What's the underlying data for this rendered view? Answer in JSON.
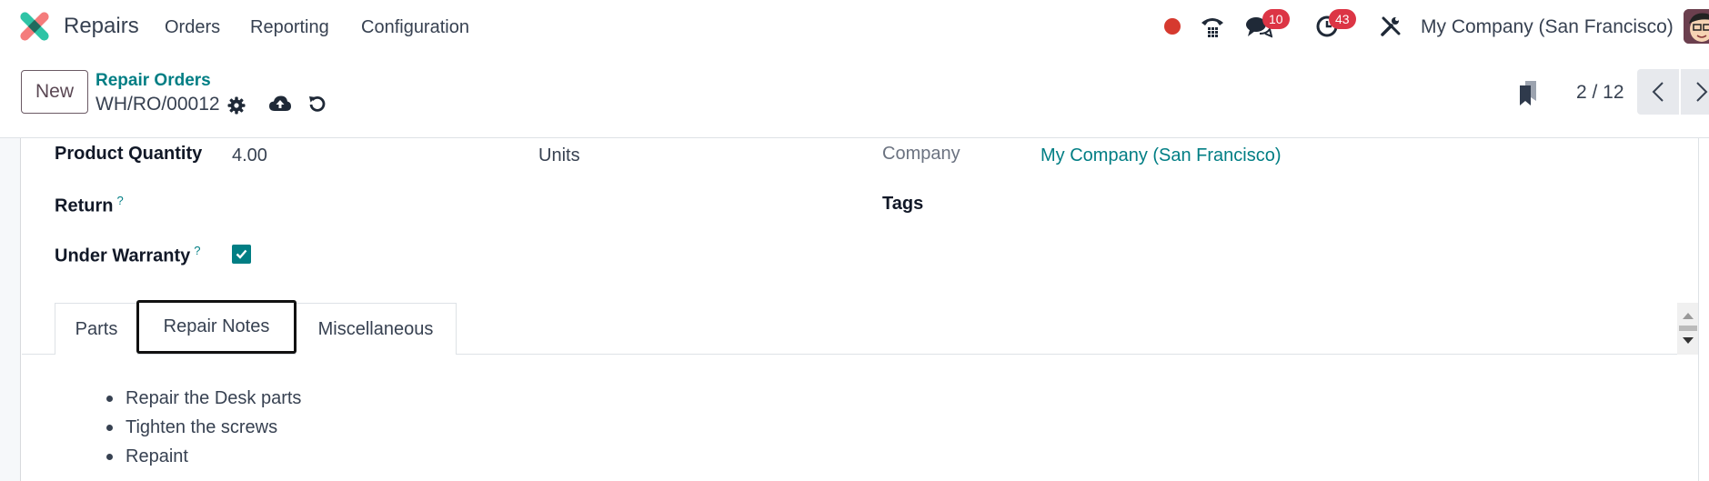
{
  "navbar": {
    "app_name": "Repairs",
    "menu": [
      "Orders",
      "Reporting",
      "Configuration"
    ],
    "status_dot_color": "#d63a2f",
    "messages_count": "10",
    "activities_count": "43",
    "company": "My Company (San Francisco)"
  },
  "control_panel": {
    "new_label": "New",
    "breadcrumb_parent": "Repair Orders",
    "breadcrumb_current": "WH/RO/00012",
    "pager_value": "2 / 12"
  },
  "form": {
    "product_quantity_label": "Product Quantity",
    "product_quantity_value": "4.00",
    "uom_value": "Units",
    "return_label": "Return",
    "help_mark": "?",
    "under_warranty_label": "Under Warranty",
    "under_warranty_checked": true,
    "company_label": "Company",
    "company_value": "My Company (San Francisco)",
    "tags_label": "Tags"
  },
  "tabs": [
    {
      "label": "Parts",
      "active": false
    },
    {
      "label": "Repair Notes",
      "active": true
    },
    {
      "label": "Miscellaneous",
      "active": false
    }
  ],
  "repair_notes": [
    "Repair the Desk parts",
    "Tighten the screws",
    "Repaint"
  ],
  "colors": {
    "accent": "#017e84",
    "badge": "#dc3545"
  }
}
